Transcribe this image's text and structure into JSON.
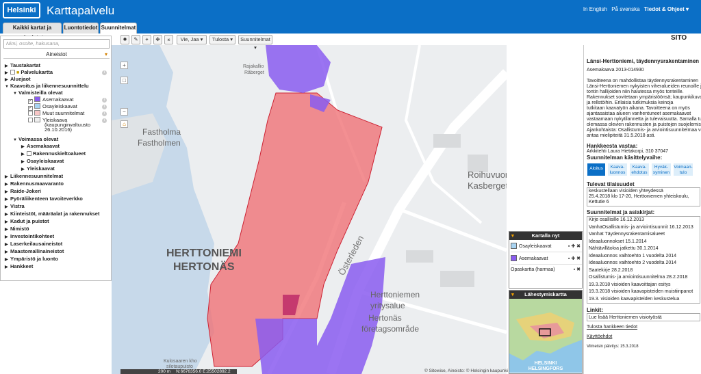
{
  "header": {
    "logo": "Helsinki",
    "title": "Karttapalvelu",
    "lang_en": "In English",
    "lang_sv": "På svenska",
    "info": "Tiedot & Ohjeet ▾"
  },
  "tabs": [
    {
      "label": "Kaikki kartat ja aineistot"
    },
    {
      "label": "Luontotiedot"
    },
    {
      "label": "Suunnitelmat"
    }
  ],
  "left": {
    "search_placeholder": "Nimi, osoite, hakusana,",
    "layers_title": "Aineistot",
    "tree": [
      {
        "label": "Taustakartat",
        "level": 0,
        "bold": true
      },
      {
        "label": "Palvelukartta",
        "level": 0,
        "bold": true
      },
      {
        "label": "Aluejaot",
        "level": 0,
        "bold": true
      },
      {
        "label": "Kaavoitus ja liikennesuunnittelu",
        "level": 0,
        "bold": true
      },
      {
        "label": "Valmisteilla olevat",
        "level": 1,
        "bold": true
      },
      {
        "label": "Asemakaavat",
        "level": 2
      },
      {
        "label": "Osayleiskaavat",
        "level": 2
      },
      {
        "label": "Muut suunnitelmat",
        "level": 2
      },
      {
        "label": "Yleiskaava",
        "level": 2
      },
      {
        "label": "(kaupunginvaltuusto",
        "level": 3
      },
      {
        "label": "26.10.2016)",
        "level": 3
      },
      {
        "label": "Voimassa olevat",
        "level": 1,
        "bold": true
      },
      {
        "label": "Asemakaavat",
        "level": 2,
        "bold": true
      },
      {
        "label": "Rakennuskieltoalueet",
        "level": 2,
        "bold": true
      },
      {
        "label": "Osayleiskaavat",
        "level": 2,
        "bold": true
      },
      {
        "label": "Yleiskaavat",
        "level": 2,
        "bold": true
      },
      {
        "label": "Liikennesuunnitelmat",
        "level": 0,
        "bold": true
      },
      {
        "label": "Rakennusmaavaranto",
        "level": 0,
        "bold": true
      },
      {
        "label": "Raide-Jokeri",
        "level": 0,
        "bold": true
      },
      {
        "label": "Pyöräliikenteen tavoiteverkko",
        "level": 0,
        "bold": true
      },
      {
        "label": "Vistra",
        "level": 0,
        "bold": true
      },
      {
        "label": "Kiinteistöt, määräalat ja rakennukset",
        "level": 0,
        "bold": true
      },
      {
        "label": "Kadut ja puistot",
        "level": 0,
        "bold": true
      },
      {
        "label": "Nimistö",
        "level": 0,
        "bold": true
      },
      {
        "label": "Investointikohteet",
        "level": 0,
        "bold": true
      },
      {
        "label": "Laserkeilausaineistot",
        "level": 0,
        "bold": true
      },
      {
        "label": "Maastomallinaineistot",
        "level": 0,
        "bold": true
      },
      {
        "label": "Ympäristö ja luonto",
        "level": 0,
        "bold": true
      },
      {
        "label": "Hankkeet",
        "level": 0,
        "bold": true
      }
    ]
  },
  "toolbar": {
    "vie": "Vie, Jaa ▾",
    "tulosta": "Tulosta ▾",
    "suunnitelmat": "Suunnitelmat ▾"
  },
  "map_labels": {
    "fastholma": "Fastholma",
    "fastholmen": "Fastholmen",
    "herttoniemi": "HERTTONIEMI",
    "hertonas": "HERTONÄS",
    "roihuvuori": "Roihuvuori",
    "kasberget": "Kasberget",
    "yritysalue1": "Herttoniemen",
    "yritysalue2": "yritysalue",
    "foretag1": "Hertonäs",
    "foretag2": "företagsområde",
    "osterleden": "Österleden",
    "rajakallio1": "Rajakallio",
    "rajakallio2": "Råberget",
    "kulosaaren": "Kulosaaren kho",
    "sarsskolan": "silotaupuisto",
    "scale": "200 m",
    "coords": "N:6676356.0 E:25502892.2",
    "copyright": "© Sitowise, Aineisto: © Helsingin kaupunki"
  },
  "kartalla": {
    "title": "Kartalla nyt",
    "rows": [
      {
        "label": "Osayleiskaavat",
        "color": "#a9d4f2"
      },
      {
        "label": "Asemakaavat",
        "color": "#8a5cf0"
      },
      {
        "label": "Opaskartta (harmaa)",
        "color": ""
      }
    ]
  },
  "lahes": {
    "title": "Lähestymiskartta",
    "city": "HELSINKI",
    "city2": "HELSINGFORS"
  },
  "right": {
    "brand": "SITO",
    "title": "Länsi-Herttoniemi, täydennysrakentaminen",
    "code": "Asemakaava 2013-014930",
    "desc": [
      "Tavoitteena on mahdollistaa täydennysrakentaminen",
      "Länsi-Herttoniemen nykyisten viheralueiden reunoille ja",
      "tontin hallijoiden niin halutessa myös tonteille.",
      "Rakennukset sovitetaan ympäristöönsä; kaupunkikuvaan",
      "ja rellstöihin. Erilaisia tutkimuksia keinoja",
      "tutkitaan kaavatyön aikana. Tavoitteena on myös",
      "ajantasaistaa alueen vanhentuneet asemakaavat",
      "vastaamaan nykytilannetta ja tulevaisuutta. Samalla tutkitaan",
      "olemassa olevien rakennusten ja puistojen suojelemista.",
      "Ajankohtaista: Osallistumis- ja arviointisuunnitelmaa voi",
      "antaa mielipiteitä 31.5.2018 asti."
    ],
    "resp_title": "Hankkeesta vastaa:",
    "resp": "Arkkitehti Laura Hietakorpi, 310 37047",
    "phase_title": "Suunnitelman käsittelyvaihe:",
    "phases": [
      {
        "label": "Aloitus",
        "on": true
      },
      {
        "label": "Kaava-luonnos"
      },
      {
        "label": "Kaava-ehdotus"
      },
      {
        "label": "Hyväk-syminen"
      },
      {
        "label": "Voimaan-tulo"
      }
    ],
    "events_title": "Tulevat tilaisuudet",
    "events": [
      "keskustellaan visioiden yhteydessä",
      "25.4.2018 klo 17-20, Herttoniemen yhteiskoulu,",
      "Kettutie 6"
    ],
    "docs_title": "Suunnitelmat ja asiakirjat:",
    "docs": [
      "Kirje osallisille 16.12.2013",
      "VanhaOsallistumis- ja arviointisuunnit 16.12.2013",
      "Vanhat Täydennysrakentamisalueet",
      "Ideaaluonnokset 15.1.2014",
      "Nähtävilläoloa jatkettu 30.1.2014",
      "Ideaaluonnos vaihtoehto 1 vuodelta 2014",
      "Ideaaluonnos vaihtoehto 2 vuodelta 2014",
      "Saatekirje 28.2.2018",
      "Osallistumis- ja arviointisuunnitelma 28.2.2018",
      "19.3.2018 visioiden kaavoittajan esitys",
      "19.3.2018 visioiden kaavapisteiden muistiinpanot",
      "19.3. visioiden kaavapisteiden keskustelua"
    ],
    "links_title": "Linkit:",
    "link1": "Lue lisää Herttoniemen visiotyöstä",
    "link2": "Tulosta hankkeen tiedot",
    "link3": "Käyttöehdot",
    "updated": "Viimeisin päivitys: 15.3.2018"
  }
}
